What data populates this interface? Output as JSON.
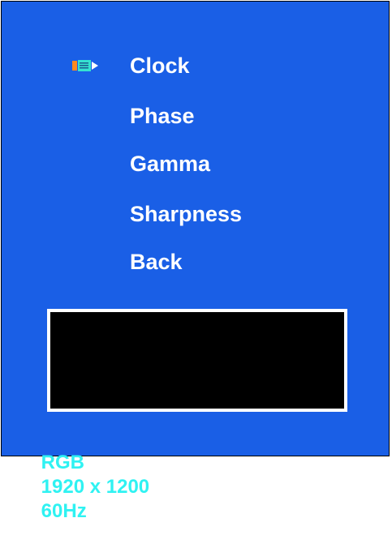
{
  "menu": {
    "selected_index": 0,
    "items": [
      {
        "label": "Clock"
      },
      {
        "label": "Phase"
      },
      {
        "label": "Gamma"
      },
      {
        "label": "Sharpness"
      },
      {
        "label": "Back"
      }
    ]
  },
  "status": {
    "signal": "RGB",
    "resolution": "1920 x 1200",
    "refresh": "60Hz"
  },
  "icons": {
    "selector": "pointer-icon"
  },
  "colors": {
    "panel_background": "#1a5fe6",
    "menu_text": "#ffffff",
    "status_text": "#2ff2f2",
    "preview_fill": "#000000",
    "preview_border": "#ffffff",
    "selector_orange": "#ff8a1f",
    "selector_cyan": "#35e3d0"
  }
}
